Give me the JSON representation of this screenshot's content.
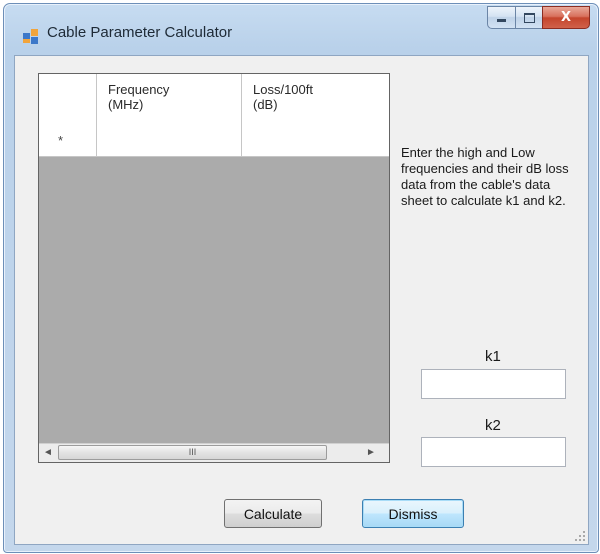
{
  "window": {
    "title": "Cable Parameter Calculator",
    "minimize_glyph": "",
    "maximize_glyph": "",
    "close_glyph": "X"
  },
  "grid": {
    "columns": [
      {
        "line1": "Frequency",
        "line2": "(MHz)"
      },
      {
        "line1": "Loss/100ft",
        "line2": "(dB)"
      }
    ],
    "new_row_marker": "*",
    "rows": [],
    "scroll_left_glyph": "◄",
    "scroll_right_glyph": "►",
    "scroll_thumb_glyph": "III"
  },
  "info_text": "Enter the high and Low frequencies and their dB loss data from the cable's data sheet to calculate k1 and k2.",
  "k1": {
    "label": "k1",
    "value": ""
  },
  "k2": {
    "label": "k2",
    "value": ""
  },
  "buttons": {
    "calculate": "Calculate",
    "dismiss": "Dismiss"
  },
  "icons": {
    "app": "app-window-icon",
    "minimize": "minimize-icon",
    "maximize": "maximize-icon",
    "close": "close-icon",
    "resize_grip": "resize-grip-icon"
  }
}
